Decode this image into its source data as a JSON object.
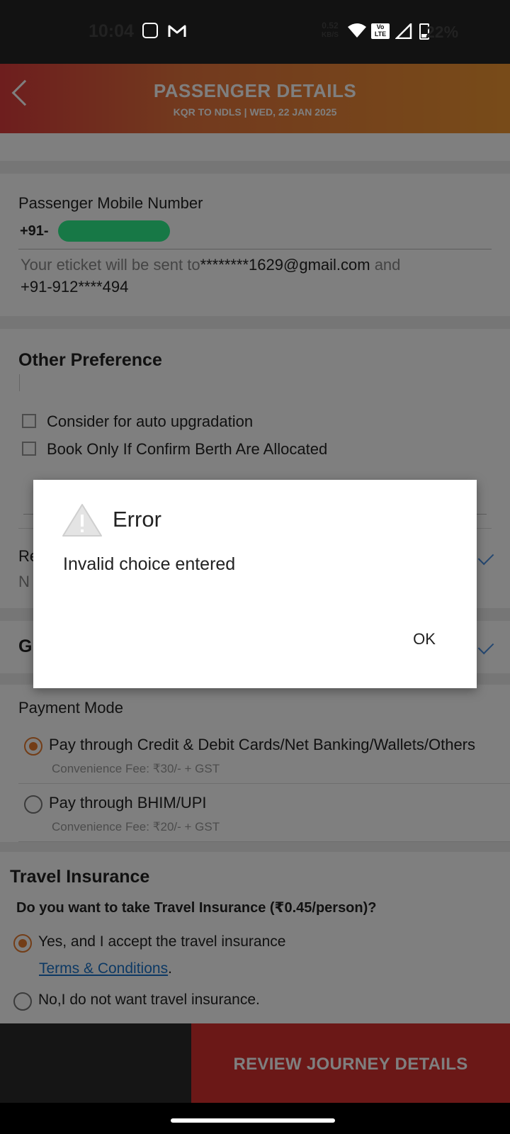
{
  "status_bar": {
    "time": "10:04",
    "net_speed_value": "0.52",
    "net_speed_unit": "KB/S",
    "volte": "Vo LTE",
    "battery": "22%",
    "icons": [
      "calculator-icon",
      "gmail-icon",
      "wifi-icon",
      "volte-icon",
      "signal-icon",
      "battery-icon"
    ]
  },
  "header": {
    "title": "PASSENGER DETAILS",
    "subtitle": "KQR TO NDLS |  WED, 22 JAN  2025"
  },
  "mobile": {
    "label": "Passenger Mobile Number",
    "prefix": "+91-",
    "eticket_prefix": "Your eticket will be sent to",
    "eticket_email": "********1629@gmail.com",
    "eticket_and": " and",
    "eticket_phone": "+91-912****494"
  },
  "other_preference": {
    "heading": "Other Preference",
    "options": [
      "Consider for auto upgradation",
      "Book Only If Confirm Berth Are Allocated"
    ],
    "partial_row1_label": "Re",
    "partial_row1_value": "N",
    "partial_row2_label": "G"
  },
  "payment": {
    "heading": "Payment Mode",
    "options": [
      {
        "label": "Pay through Credit & Debit Cards/Net Banking/Wallets/Others",
        "fee": "Convenience Fee: ₹30/- + GST",
        "selected": true
      },
      {
        "label": "Pay through BHIM/UPI",
        "fee": "Convenience Fee: ₹20/- + GST",
        "selected": false
      }
    ]
  },
  "insurance": {
    "heading": "Travel Insurance",
    "question": "Do you want to take Travel Insurance (₹0.45/person)?",
    "yes_label": "Yes, and I accept the travel insurance",
    "terms_link": "Terms & Conditions",
    "terms_suffix": ".",
    "no_label": "No,I do not want travel insurance."
  },
  "bottom": {
    "review_button": "REVIEW JOURNEY DETAILS"
  },
  "dialog": {
    "title": "Error",
    "message": "Invalid choice entered",
    "ok_label": "OK"
  },
  "colors": {
    "accent_orange": "#e67b2e",
    "header_red": "#dc3c3c",
    "cta_red": "#d6312f",
    "link_blue": "#1a73c8"
  }
}
